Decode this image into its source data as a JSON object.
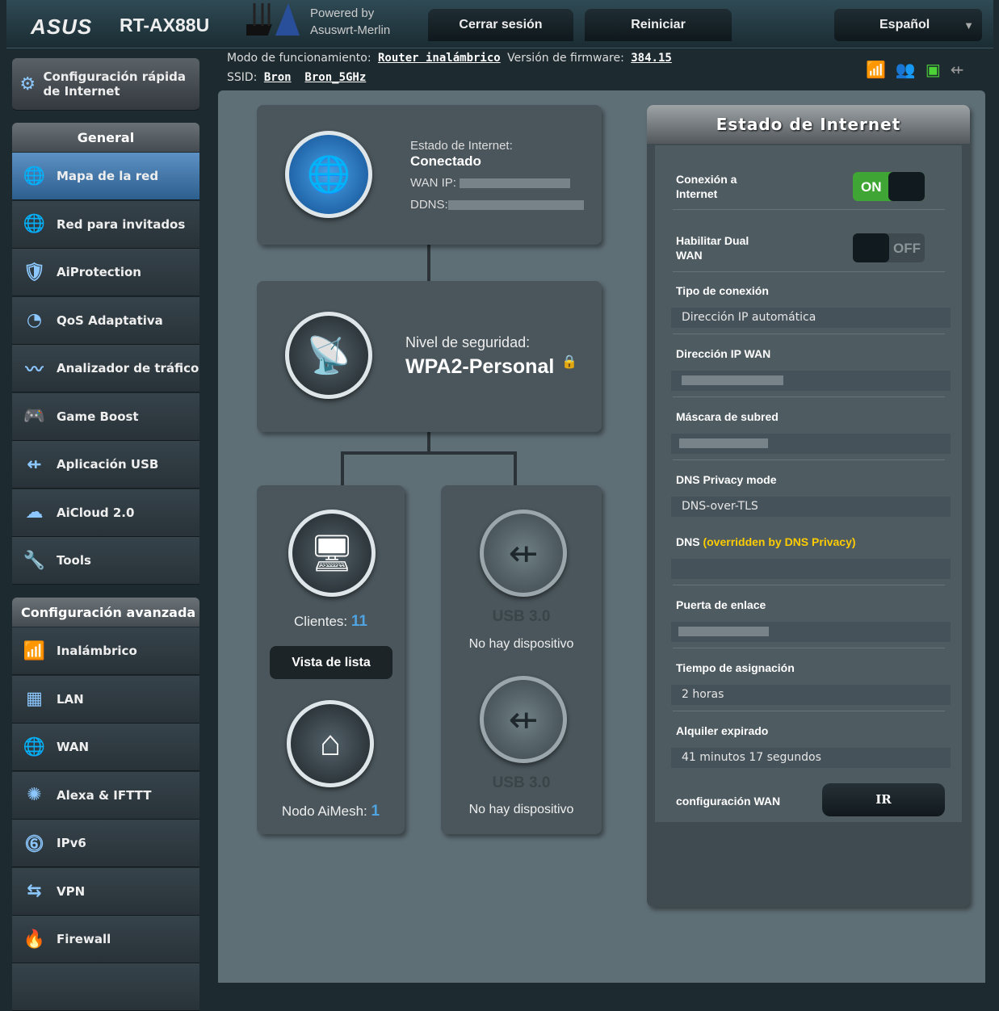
{
  "header": {
    "brand": "ASUS",
    "model": "RT-AX88U",
    "powered_line1": "Powered by",
    "powered_line2": "Asuswrt-Merlin",
    "logout": "Cerrar sesión",
    "reboot": "Reiniciar",
    "language": "Español"
  },
  "info": {
    "mode_label": "Modo de funcionamiento:",
    "mode_value": "Router inalámbrico",
    "fw_label": "Versión de firmware:",
    "fw_value": "384.15",
    "ssid_label": "SSID:",
    "ssid1": "Bron",
    "ssid2": "Bron_5GHz"
  },
  "sidebar": {
    "quick_setup": "Configuración rápida de Internet",
    "general_header": "General",
    "general": [
      {
        "label": "Mapa de la red",
        "icon": "globe-icon"
      },
      {
        "label": "Red para invitados",
        "icon": "guest-icon"
      },
      {
        "label": "AiProtection",
        "icon": "shield-icon"
      },
      {
        "label": "QoS Adaptativa",
        "icon": "gauge-icon"
      },
      {
        "label": "Analizador de tráfico",
        "icon": "traffic-icon"
      },
      {
        "label": "Game Boost",
        "icon": "gamepad-icon"
      },
      {
        "label": "Aplicación USB",
        "icon": "usb-icon"
      },
      {
        "label": "AiCloud 2.0",
        "icon": "cloud-icon"
      },
      {
        "label": "Tools",
        "icon": "wrench-icon"
      }
    ],
    "advanced_header": "Configuración avanzada",
    "advanced": [
      {
        "label": "Inalámbrico",
        "icon": "wireless-icon"
      },
      {
        "label": "LAN",
        "icon": "lan-icon"
      },
      {
        "label": "WAN",
        "icon": "globe-icon"
      },
      {
        "label": "Alexa & IFTTT",
        "icon": "alexa-icon"
      },
      {
        "label": "IPv6",
        "icon": "ipv6-icon"
      },
      {
        "label": "VPN",
        "icon": "vpn-icon"
      },
      {
        "label": "Firewall",
        "icon": "firewall-icon"
      }
    ]
  },
  "map": {
    "internet_status_label": "Estado de Internet:",
    "internet_status": "Conectado",
    "wan_ip_label": "WAN IP:",
    "ddns_label": "DDNS:",
    "security_label": "Nivel de seguridad:",
    "security_value": "WPA2-Personal",
    "clients_label": "Clientes:",
    "clients_count": "11",
    "list_view": "Vista de lista",
    "aimesh_label": "Nodo AiMesh:",
    "aimesh_count": "1",
    "usb1_title": "USB 3.0",
    "usb1_status": "No hay dispositivo",
    "usb2_title": "USB 3.0",
    "usb2_status": "No hay dispositivo"
  },
  "status_panel": {
    "title": "Estado de Internet",
    "conn_label": "Conexión a Internet",
    "conn_toggle": "ON",
    "dualwan_label": "Habilitar Dual WAN",
    "dualwan_toggle": "OFF",
    "type_label": "Tipo de conexión",
    "type_value": "Dirección IP automática",
    "wanip_label": "Dirección IP WAN",
    "mask_label": "Máscara de subred",
    "dnspriv_label": "DNS Privacy mode",
    "dnspriv_value": "DNS-over-TLS",
    "dns_label": "DNS",
    "dns_note": "(overridden by DNS Privacy)",
    "gateway_label": "Puerta de enlace",
    "lease_label": "Tiempo de asignación",
    "lease_value": "2 horas",
    "expire_label": "Alquiler expirado",
    "expire_value": "41 minutos 17 segundos",
    "wancfg_label": "configuración WAN",
    "go_button": "IR"
  },
  "colors": {
    "accent_green": "#3fa535",
    "note_yellow": "#ffcc00",
    "active_blue": "#4a7fb2",
    "count_blue": "#4fa3e0"
  }
}
